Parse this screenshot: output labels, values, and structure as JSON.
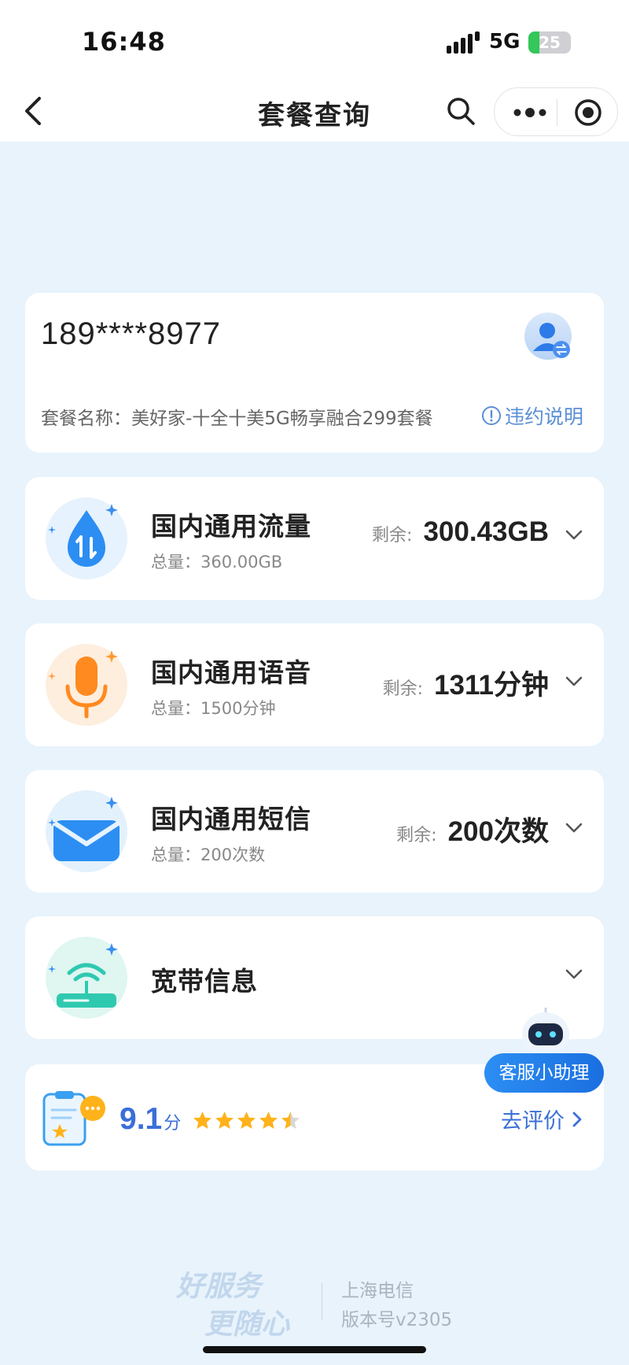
{
  "status_bar": {
    "time": "16:48",
    "network": "5G",
    "battery_percent": 25,
    "battery_label": "25",
    "battery_color": "#34c759"
  },
  "nav": {
    "title": "套餐查询",
    "back_icon": "chevron-left-icon",
    "search_icon": "search-icon",
    "more_icon": "more-dots-icon",
    "close_icon": "target-icon"
  },
  "account": {
    "phone": "189****8977",
    "plan_name": "套餐名称：美好家-十全十美5G畅享融合299套餐",
    "violation_label": "违约说明",
    "link_color": "#5b8fd6"
  },
  "usage": [
    {
      "title": "国内通用流量",
      "total": "总量：360.00GB",
      "remain_label": "剩余:",
      "remain": "300.43GB",
      "icon": "data-drop-icon"
    },
    {
      "title": "国内通用语音",
      "total": "总量：1500分钟",
      "remain_label": "剩余:",
      "remain": "1311分钟",
      "icon": "microphone-icon"
    },
    {
      "title": "国内通用短信",
      "total": "总量：200次数",
      "remain_label": "剩余:",
      "remain": "200次数",
      "icon": "envelope-icon"
    },
    {
      "title": "宽带信息",
      "icon": "router-icon"
    }
  ],
  "rating": {
    "score": "9.1",
    "unit": "分",
    "stars": 4.5,
    "action": "去评价",
    "accent": "#3a6fd8"
  },
  "assistant": {
    "label": "客服小助理",
    "icon": "robot-icon"
  },
  "footer": {
    "slogan_line1": "好服务",
    "slogan_line2": "更随心",
    "company": "上海电信",
    "version": "版本号v2305"
  },
  "colors": {
    "page_bg": "#e8f3fc",
    "primary": "#1b6fe0"
  }
}
